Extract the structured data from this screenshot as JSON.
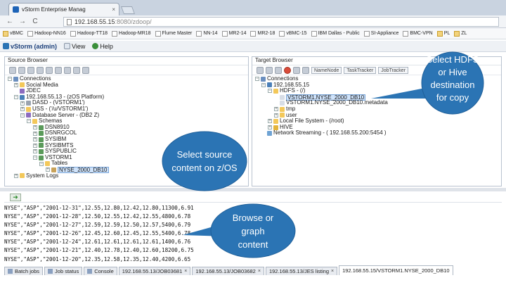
{
  "browser": {
    "tab_title": "vStorm Enterprise Manag",
    "tab_close": "×",
    "url_host": "192.168.55.15",
    "url_path": ":8080/zdoop/",
    "nav_back": "←",
    "nav_forward": "→",
    "nav_reload": "C"
  },
  "bookmarks": [
    {
      "label": "vBMC",
      "icon": "folder"
    },
    {
      "label": "Hadoop-NN16",
      "icon": "page"
    },
    {
      "label": "Hadoop-TT18",
      "icon": "page"
    },
    {
      "label": "Hadoop-MR18",
      "icon": "page"
    },
    {
      "label": "Flume Master",
      "icon": "page"
    },
    {
      "label": "NN-14",
      "icon": "page"
    },
    {
      "label": "MR2-14",
      "icon": "page"
    },
    {
      "label": "MR2-18",
      "icon": "page"
    },
    {
      "label": "vBMC-15",
      "icon": "page"
    },
    {
      "label": "IBM Dallas - Public",
      "icon": "page"
    },
    {
      "label": "SI-Appliance",
      "icon": "page"
    },
    {
      "label": "BMC-VPN",
      "icon": "page"
    },
    {
      "label": "PL",
      "icon": "folder"
    },
    {
      "label": "ZL",
      "icon": "folder"
    }
  ],
  "menubar": {
    "app_label": "vStorm (admin)",
    "view_label": "View",
    "help_label": "Help"
  },
  "source": {
    "title": "Source Browser",
    "tree": [
      {
        "label": "Connections",
        "indent": 0,
        "icon": "conn",
        "expander": "−"
      },
      {
        "label": "Social Media",
        "indent": 1,
        "icon": "folder",
        "expander": "+"
      },
      {
        "label": "JDEC",
        "indent": 1,
        "icon": "db",
        "expander": ""
      },
      {
        "label": "192.168.55.13 - (zOS Platform)",
        "indent": 1,
        "icon": "host",
        "expander": "−"
      },
      {
        "label": "DASD - (VSTORM1')",
        "indent": 2,
        "icon": "disk",
        "expander": "+"
      },
      {
        "label": "USS - ('/u/VSTORM1')",
        "indent": 2,
        "icon": "folder",
        "expander": "+"
      },
      {
        "label": "Database Server - (DB2 Z)",
        "indent": 2,
        "icon": "db",
        "expander": "−"
      },
      {
        "label": "Schemas",
        "indent": 3,
        "icon": "folder",
        "expander": "−"
      },
      {
        "label": "DSN8910",
        "indent": 4,
        "icon": "schema",
        "expander": "+"
      },
      {
        "label": "DSNRGCOL",
        "indent": 4,
        "icon": "schema",
        "expander": "+"
      },
      {
        "label": "SYSIBM",
        "indent": 4,
        "icon": "schema",
        "expander": "+"
      },
      {
        "label": "SYSIBMTS",
        "indent": 4,
        "icon": "schema",
        "expander": "+"
      },
      {
        "label": "SYSPUBLIC",
        "indent": 4,
        "icon": "schema",
        "expander": "+"
      },
      {
        "label": "VSTORM1",
        "indent": 4,
        "icon": "schema",
        "expander": "−"
      },
      {
        "label": "Tables",
        "indent": 5,
        "icon": "folder",
        "expander": "−"
      },
      {
        "label": "NYSE_2000_DB10",
        "indent": 6,
        "icon": "table",
        "expander": "+",
        "highlight": true
      },
      {
        "label": "System Logs",
        "indent": 1,
        "icon": "folder",
        "expander": "+"
      }
    ]
  },
  "target": {
    "title": "Target Browser",
    "toolbar_tags": [
      "NameNode",
      "TaskTracker",
      "JobTracker"
    ],
    "tree": [
      {
        "label": "Connections",
        "indent": 0,
        "icon": "conn",
        "expander": "−"
      },
      {
        "label": "192.168.55.15",
        "indent": 1,
        "icon": "host",
        "expander": "−"
      },
      {
        "label": "HDFS - (/)",
        "indent": 2,
        "icon": "folder",
        "expander": "−"
      },
      {
        "label": "VSTORM1.NYSE_2000_DB10",
        "indent": 3,
        "icon": "file",
        "expander": "",
        "highlight": true
      },
      {
        "label": "VSTORM1.NYSE_2000_DB10.metadata",
        "indent": 3,
        "icon": "file",
        "expander": ""
      },
      {
        "label": "tmp",
        "indent": 3,
        "icon": "folder",
        "expander": "+"
      },
      {
        "label": "user",
        "indent": 3,
        "icon": "folder",
        "expander": "+"
      },
      {
        "label": "Local File System - (/root)",
        "indent": 2,
        "icon": "folder",
        "expander": "+"
      },
      {
        "label": "HIVE",
        "indent": 2,
        "icon": "hive",
        "expander": "+"
      },
      {
        "label": "Network Streaming - ( 192.168.55.200:5454 )",
        "indent": 1,
        "icon": "net",
        "expander": ""
      }
    ]
  },
  "data_lines": [
    "NYSE\",\"ASP\",\"2001-12-31\",12.55,12.80,12.42,12.80,11300,6.91",
    "NYSE\",\"ASP\",\"2001-12-28\",12.50,12.55,12.42,12.55,4800,6.78",
    "NYSE\",\"ASP\",\"2001-12-27\",12.59,12.59,12.50,12.57,5400,6.79",
    "NYSE\",\"ASP\",\"2001-12-26\",12.45,12.60,12.45,12.55,5400,6.78",
    "NYSE\",\"ASP\",\"2001-12-24\",12.61,12.61,12.61,12.61,1400,6.76",
    "NYSE\",\"ASP\",\"2001-12-21\",12.40,12.78,12.40,12.60,18200,6.75",
    "NYSE\",\"ASP\",\"2001-12-20\",12.35,12.58,12.35,12.40,4200,6.65"
  ],
  "bottom_tabs": [
    {
      "label": "Batch jobs",
      "close": false,
      "active": false
    },
    {
      "label": "Job status",
      "close": false,
      "active": false
    },
    {
      "label": "Console",
      "close": false,
      "active": false
    },
    {
      "label": "192.168.55.13/JOB03681",
      "close": true,
      "active": false
    },
    {
      "label": "192.168.55.13/JOB03682",
      "close": true,
      "active": false
    },
    {
      "label": "192.168.55.13/JES listing",
      "close": true,
      "active": false
    },
    {
      "label": "192.168.55.15/VSTORM1.NYSE_2000_DB10",
      "close": false,
      "active": true
    }
  ],
  "callouts": {
    "source": "Select source content on z/OS",
    "target": "Select HDFS or Hive destination for copy",
    "data": "Browse or graph content"
  },
  "colors": {
    "callout": "#2b74b4",
    "highlight": "#cfe3fb"
  }
}
